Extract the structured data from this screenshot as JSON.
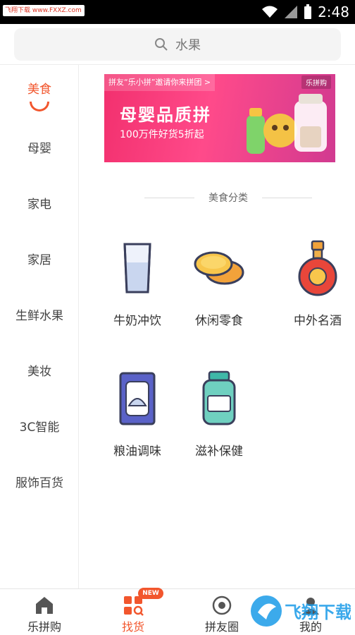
{
  "status_bar": {
    "watermark": "飞翔下载 www.FXXZ.com",
    "time": "2:48"
  },
  "search": {
    "placeholder": "水果"
  },
  "sidebar": {
    "items": [
      {
        "label": "美食",
        "active": true
      },
      {
        "label": "母婴"
      },
      {
        "label": "家电"
      },
      {
        "label": "家居"
      },
      {
        "label": "生鲜水果"
      },
      {
        "label": "美妆"
      },
      {
        "label": "3C智能"
      },
      {
        "label": "服饰百货"
      }
    ]
  },
  "banner": {
    "invite": "拼友“乐小拼”邀请你来拼团 >",
    "brand": "乐拼购",
    "title": "母婴品质拼",
    "subtitle": "100万件好货5折起"
  },
  "section": {
    "title": "美食分类"
  },
  "categories": [
    {
      "label": "牛奶冲饮",
      "icon": "milk-glass-icon"
    },
    {
      "label": "休闲零食",
      "icon": "snack-icon"
    },
    {
      "label": "中外名酒",
      "icon": "liquor-bottle-icon"
    },
    {
      "label": "粮油调味",
      "icon": "grain-bag-icon"
    },
    {
      "label": "滋补保健",
      "icon": "supplement-bottle-icon"
    }
  ],
  "tabbar": {
    "tabs": [
      {
        "label": "乐拼购",
        "icon": "home-icon"
      },
      {
        "label": "找货",
        "icon": "grid-search-icon",
        "active": true
      },
      {
        "label": "拼友圈",
        "icon": "circle-icon",
        "badge": "NEW"
      },
      {
        "label": "我的",
        "icon": "profile-icon"
      }
    ]
  },
  "watermark_logo": "飞翔下载",
  "colors": {
    "accent": "#f2562d",
    "banner": "#f2306e"
  }
}
